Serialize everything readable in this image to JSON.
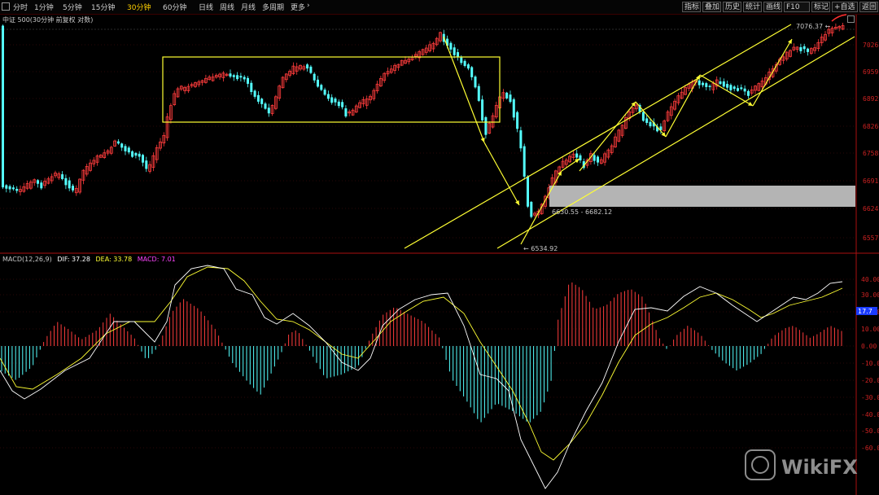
{
  "toolbar": {
    "tabs": [
      {
        "label": "分时"
      },
      {
        "label": "1分钟"
      },
      {
        "label": "5分钟"
      },
      {
        "label": "15分钟"
      },
      {
        "label": "30分钟",
        "active": true
      },
      {
        "label": "60分钟"
      },
      {
        "label": "日线"
      },
      {
        "label": "周线"
      },
      {
        "label": "月线"
      },
      {
        "label": "多周期"
      },
      {
        "label": "更多"
      }
    ],
    "more_arrow": "›",
    "right_buttons": [
      "指标",
      "叠加",
      "历史",
      "统计",
      "画线",
      "F10",
      "标记",
      "+自选",
      "返回"
    ]
  },
  "chart_title": "中证 500(30分钟 前复权 对数)",
  "price_axis": [
    "7026",
    "6959",
    "6892",
    "6826",
    "6758",
    "6691",
    "6624",
    "6557"
  ],
  "price_labels": {
    "high": "7076.37",
    "low": "6534.92",
    "gap": "6630.55 - 6682.12"
  },
  "macd": {
    "label": "MACD(12,26,9)",
    "dif_label": "DIF: 37.28",
    "dea_label": "DEA: 33.78",
    "macd_label": "MACD: 7.01",
    "axis": [
      "40.00",
      "30.00",
      "20.00",
      "10.00",
      "0.00",
      "-10.00",
      "-20.00",
      "-30.00",
      "-40.00",
      "-50.00",
      "-60.00"
    ],
    "marker": "17.7"
  },
  "watermark": "WikiFX",
  "colors": {
    "up": "#ff3c3c",
    "down": "#54ffff",
    "dif": "#ffffff",
    "dea": "#ffff33",
    "annotation": "#ffff33",
    "axis": "#cc2222"
  }
}
